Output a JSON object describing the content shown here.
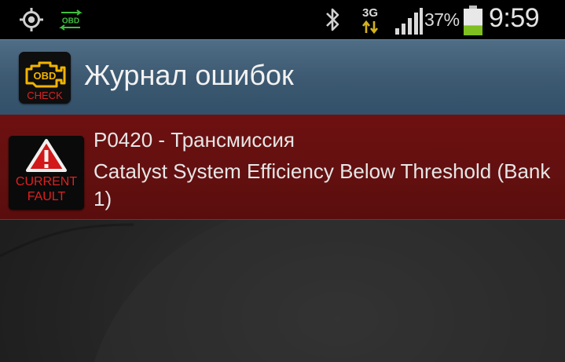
{
  "status_bar": {
    "icons": [
      "gps-icon",
      "obd-notification-icon",
      "bluetooth-icon",
      "network-3g-icon",
      "signal-icon",
      "battery-icon"
    ],
    "network_type": "3G",
    "obd_label": "OBD",
    "battery_percent": "37%",
    "battery_level": 0.37,
    "time": "9:59"
  },
  "header": {
    "app_icon_text_top": "OBD",
    "app_icon_text_bottom": "CHECK",
    "title": "Журнал ошибок"
  },
  "faults": [
    {
      "icon_line1": "CURRENT",
      "icon_line2": "FAULT",
      "code_line": "P0420 - Трансмиссия",
      "description": "Catalyst System Efficiency Below Threshold (Bank 1)"
    }
  ],
  "colors": {
    "title_bar": "#3d5a72",
    "fault_row": "#641010",
    "battery_fill": "#7fbf1f",
    "obd_green": "#3fbf3f"
  }
}
